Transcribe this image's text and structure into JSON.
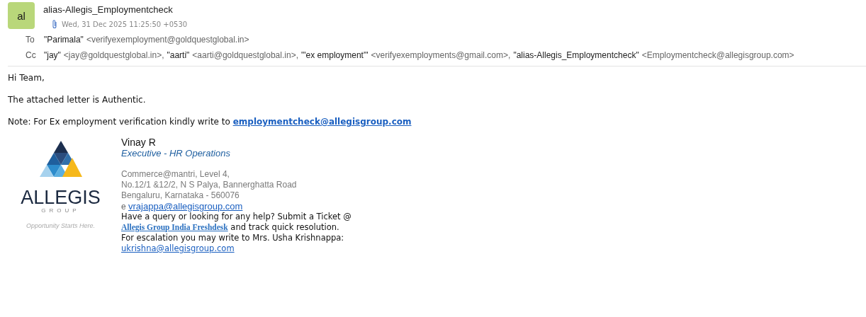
{
  "header": {
    "avatar": "al",
    "sender": "alias-Allegis_Employmentcheck",
    "has_attachment": true,
    "date": "Wed, 31 Dec 2025 11:25:50 +0530",
    "to_label": "To",
    "to": [
      {
        "name": "\"Parimala\"",
        "address": "<verifyexemployment@goldquestglobal.in>"
      }
    ],
    "cc_label": "Cc",
    "cc": [
      {
        "name": "\"jay\"",
        "address": "<jay@goldquestglobal.in>,"
      },
      {
        "name": "\"aarti\"",
        "address": "<aarti@goldquestglobal.in>,"
      },
      {
        "name": "\"'ex employment'\"",
        "address": "<verifyexemployments@gmail.com>,"
      },
      {
        "name": "\"alias-Allegis_Employmentcheck\"",
        "address": "<Employmentcheck@allegisgroup.com>"
      }
    ]
  },
  "body": {
    "greeting": "Hi Team,",
    "line": "The attached letter is Authentic.",
    "note": "Note: For Ex employment verification kindly write to",
    "note_link": "employmentcheck@allegisgroup.com"
  },
  "signature": {
    "logo_word": "ALLEGIS",
    "logo_sub": "GROUP",
    "tagline": "Opportunity Starts Here.",
    "name": "Vinay R",
    "title": "Executive - HR Operations",
    "address": [
      "Commerce@mantri, Level 4,",
      "No.12/1 &12/2, N S Palya, Bannerghatta Road",
      "Bengaluru, Karnataka - 560076"
    ],
    "email_label": "e",
    "email": "vrajappa@allegisgroup.com",
    "ticket_text": "Have a query or looking for any help? Submit a Ticket @",
    "ticket_link": "Allegis Group India Freshdesk",
    "ticket_after": "and track quick resolution.",
    "escalation": "For escalation you may write to Mrs. Usha Krishnappa:",
    "escalation_email": "ukrishna@allegisgroup.com"
  }
}
